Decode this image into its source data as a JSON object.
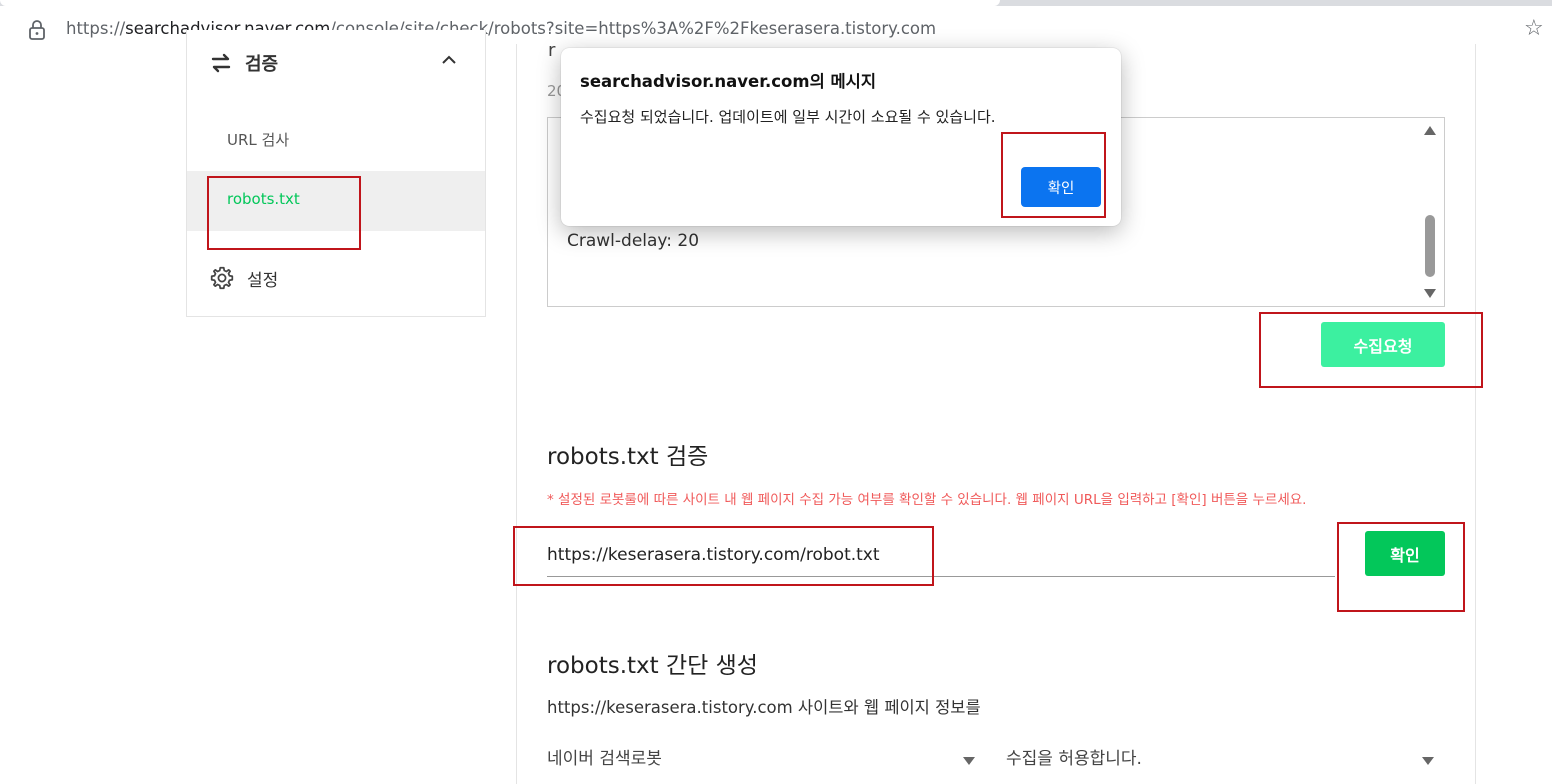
{
  "browser": {
    "url_prefix": "https://",
    "url_host": "searchadvisor.naver.com",
    "url_path": "/console/site/check/robots?site=https%3A%2F%2Fkeserasera.tistory.com"
  },
  "sidebar": {
    "section_label": "검증",
    "items": [
      {
        "label": "URL 검사"
      },
      {
        "label": "robots.txt"
      }
    ],
    "settings_label": "설정"
  },
  "main": {
    "partial_heading": "r",
    "date_prefix": "20",
    "robots_content_line": "Crawl-delay: 20",
    "collect_button_label": "수집요청",
    "verify_heading": "robots.txt 검증",
    "verify_note": "* 설정된 로봇룰에 따른 사이트 내 웹 페이지 수집 가능 여부를 확인할 수 있습니다. 웹 페이지 URL을 입력하고 [확인] 버튼을 누르세요.",
    "verify_input_value": "https://keserasera.tistory.com/robot.txt",
    "verify_button_label": "확인",
    "generate_heading": "robots.txt 간단 생성",
    "generate_desc": "https://keserasera.tistory.com 사이트와 웹 페이지 정보를",
    "robot_select_value": "네이버 검색로봇",
    "allow_select_value": "수집을 허용합니다."
  },
  "dialog": {
    "title": "searchadvisor.naver.com의 메시지",
    "message": "수집요청 되었습니다. 업데이트에 일부 시간이 소요될 수 있습니다.",
    "ok_label": "확인"
  },
  "colors": {
    "naver_green": "#03c75a",
    "collect_green": "#3cf0a0",
    "dialog_blue": "#0b74f0",
    "annotation_red": "#c0151b",
    "note_red": "#f05a5a"
  }
}
